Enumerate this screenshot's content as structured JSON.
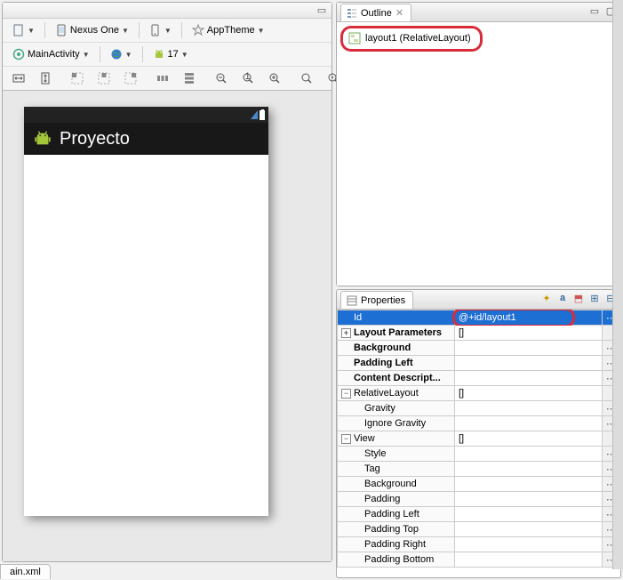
{
  "left": {
    "device_label": "Nexus One",
    "theme_label": "AppTheme",
    "activity_label": "MainActivity",
    "api_level": "17",
    "app_title": "Proyecto"
  },
  "outline": {
    "tab_label": "Outline",
    "tree_item": "layout1 (RelativeLayout)"
  },
  "properties": {
    "tab_label": "Properties",
    "rows": {
      "id_name": "Id",
      "id_val": "@+id/layout1",
      "layout_params": "Layout Parameters",
      "layout_params_val": "[]",
      "background": "Background",
      "padding_left": "Padding Left",
      "content_desc": "Content Descript...",
      "relativelayout": "RelativeLayout",
      "relativelayout_val": "[]",
      "gravity": "Gravity",
      "ignore_gravity": "Ignore Gravity",
      "view": "View",
      "view_val": "[]",
      "style": "Style",
      "tag": "Tag",
      "bg2": "Background",
      "padding": "Padding",
      "pl2": "Padding Left",
      "pt": "Padding Top",
      "pr": "Padding Right",
      "pb": "Padding Bottom"
    }
  },
  "file_tab": "ain.xml"
}
